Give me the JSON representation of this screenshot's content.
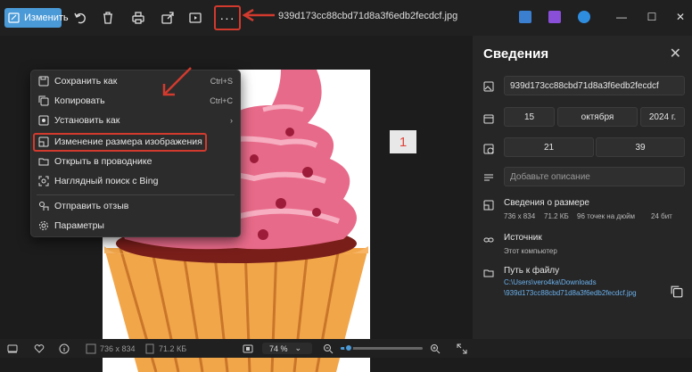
{
  "toolbar": {
    "edit_label": "Изменить",
    "more_label": "···",
    "filename": "939d173cc88cbd71d8a3f6edb2fecdcf.jpg"
  },
  "menu": {
    "items": [
      {
        "label": "Сохранить как",
        "shortcut": "Ctrl+S"
      },
      {
        "label": "Копировать",
        "shortcut": "Ctrl+C"
      },
      {
        "label": "Установить как",
        "shortcut": "›"
      },
      {
        "label": "Изменение размера изображения",
        "shortcut": ""
      },
      {
        "label": "Открыть в проводнике",
        "shortcut": ""
      },
      {
        "label": "Наглядный поиск с Bing",
        "shortcut": ""
      },
      {
        "label": "Отправить отзыв",
        "shortcut": ""
      },
      {
        "label": "Параметры",
        "shortcut": ""
      }
    ]
  },
  "annotation": {
    "step": "1"
  },
  "panel": {
    "title": "Сведения",
    "file_name": "939d173cc88cbd71d8a3f6edb2fecdcf",
    "date_day": "15",
    "date_month": "октября",
    "date_year": "2024 г.",
    "time_hour": "21",
    "time_minute": "39",
    "description_placeholder": "Добавьте описание",
    "size_title": "Сведения о размере",
    "size_dims": "736 x 834",
    "size_kb": "71.2 КБ",
    "size_dpi": "96 точек на дюйм",
    "size_bits": "24 бит",
    "source_title": "Источник",
    "source_value": "Этот компьютер",
    "path_title": "Путь к файлу",
    "path_line1": "C:\\Users\\vero4ka\\Downloads",
    "path_line2": "\\939d173cc88cbd71d8a3f6edb2fecdcf.jpg"
  },
  "statusbar": {
    "dims": "736 x 834",
    "size": "71.2 КБ",
    "zoom": "74 %",
    "zoom_level": 0.1
  },
  "colors": {
    "accent": "#4a9ad8",
    "highlight_red": "#d23a2e",
    "link": "#6ab0ec"
  }
}
